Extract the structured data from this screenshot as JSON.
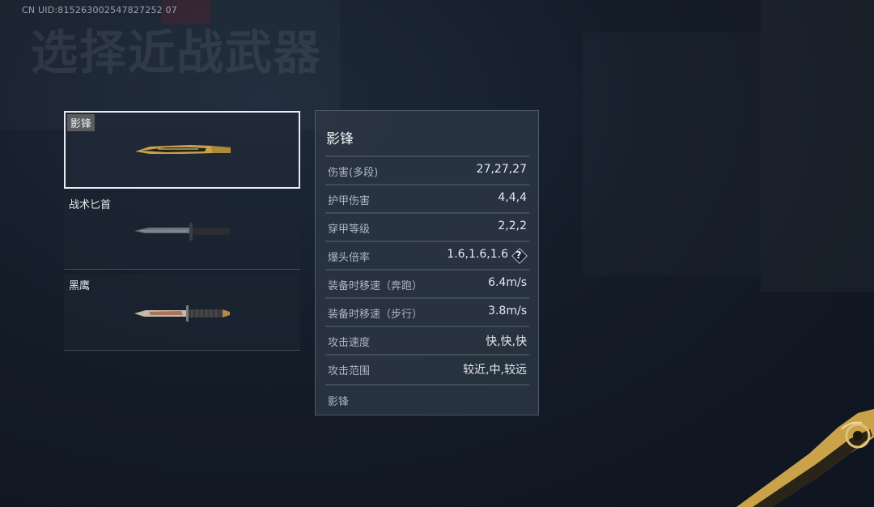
{
  "uid": "CN UID:815263002547827252 07",
  "page_title": "选择近战武器",
  "weapons": [
    {
      "name": "影锋",
      "selected": true,
      "icon": "golden-knife-icon"
    },
    {
      "name": "战术匕首",
      "selected": false,
      "icon": "tactical-dagger-icon"
    },
    {
      "name": "黑鹰",
      "selected": false,
      "icon": "blackhawk-knife-icon"
    }
  ],
  "detail": {
    "title": "影锋",
    "stats": [
      {
        "label": "伤害(多段)",
        "value": "27,27,27"
      },
      {
        "label": "护甲伤害",
        "value": "4,4,4"
      },
      {
        "label": "穿甲等级",
        "value": "2,2,2"
      },
      {
        "label": "爆头倍率",
        "value": "1.6,1.6,1.6",
        "help": "?"
      },
      {
        "label": "装备时移速（奔跑）",
        "value": "6.4m/s"
      },
      {
        "label": "装备时移速（步行）",
        "value": "3.8m/s"
      },
      {
        "label": "攻击速度",
        "value": "快,快,快"
      },
      {
        "label": "攻击范围",
        "value": "较近,中,较远"
      }
    ],
    "footer": "影锋"
  },
  "colors": {
    "background": "#141c28",
    "panel": "#2c3644",
    "selected_border": "#e8ecf0",
    "gold": "#c9a24a"
  }
}
